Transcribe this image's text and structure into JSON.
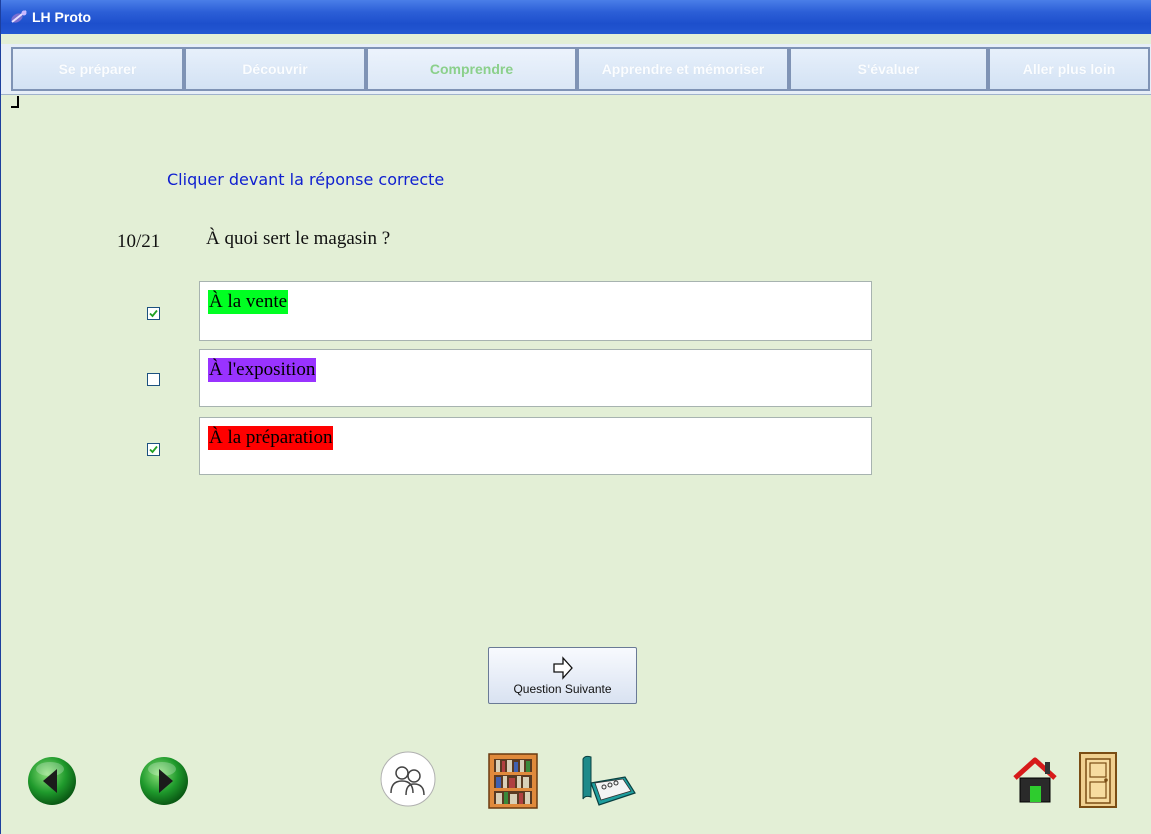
{
  "window": {
    "title": "LH Proto"
  },
  "tabs": [
    {
      "label": "Se préparer",
      "active": false
    },
    {
      "label": "Découvrir",
      "active": false
    },
    {
      "label": "Comprendre",
      "active": true
    },
    {
      "label": "Apprendre et mémoriser",
      "active": false
    },
    {
      "label": "S'évaluer",
      "active": false
    },
    {
      "label": "Aller plus loin",
      "active": false
    }
  ],
  "quiz": {
    "instruction": "Cliquer devant la réponse correcte",
    "counter": "10/21",
    "question": "À quoi sert le magasin ?",
    "answers": [
      {
        "text": "À la vente",
        "checked": true,
        "highlight": "#00ff22"
      },
      {
        "text": "À l'exposition",
        "checked": false,
        "highlight": "#9933ff"
      },
      {
        "text": "À la préparation",
        "checked": true,
        "highlight": "#ff0000"
      }
    ]
  },
  "buttons": {
    "next_label": "Question Suivante"
  },
  "icons": {
    "prev": "arrow-left-icon",
    "next": "arrow-right-icon",
    "people": "people-icon",
    "library": "bookshelf-icon",
    "binder": "binder-icon",
    "home": "home-icon",
    "exit": "door-icon"
  },
  "colors": {
    "background": "#e3efd6",
    "instruction": "#1020d0",
    "active_tab": "#8bd08b"
  }
}
